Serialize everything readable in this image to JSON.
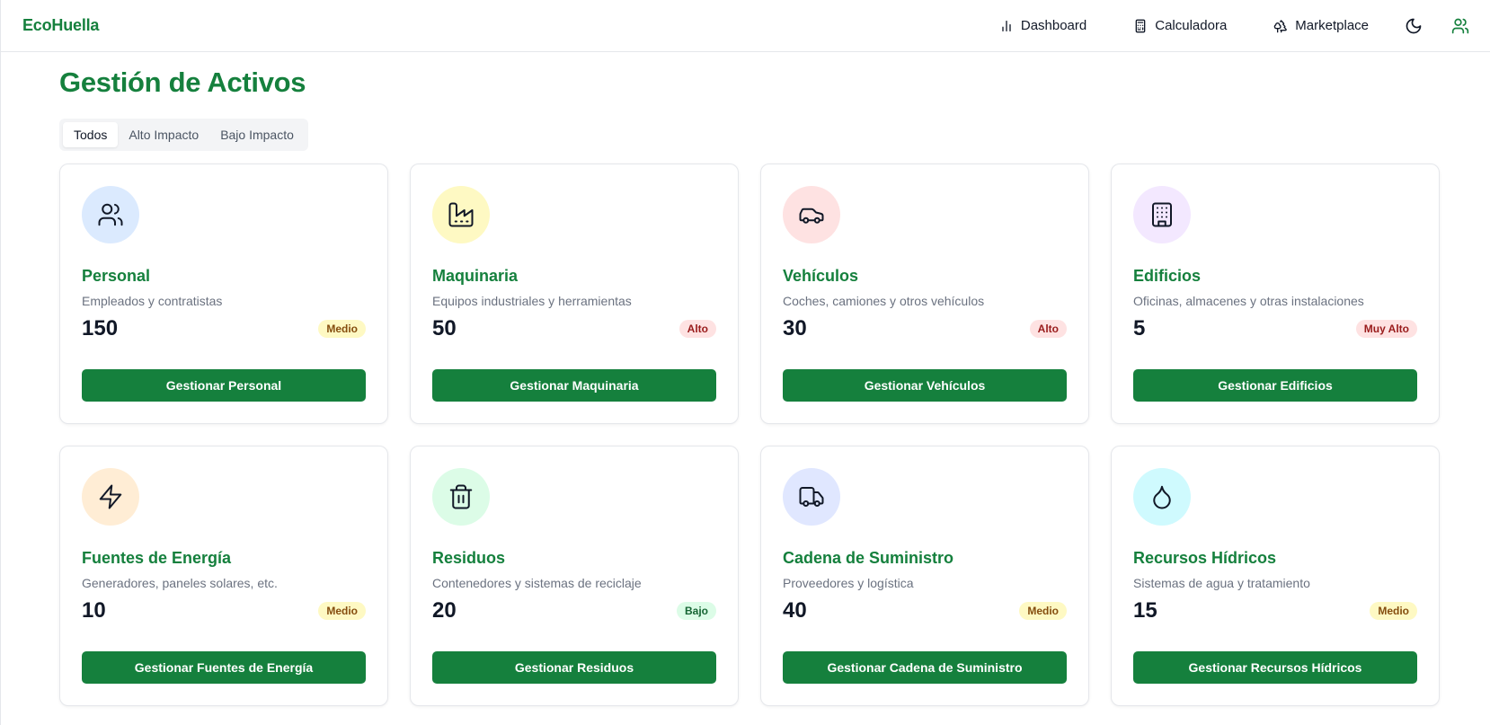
{
  "app": {
    "brand": "EcoHuella"
  },
  "nav": {
    "items": [
      {
        "label": "Dashboard",
        "icon": "bar-chart-icon"
      },
      {
        "label": "Calculadora",
        "icon": "calculator-icon"
      },
      {
        "label": "Marketplace",
        "icon": "trees-icon"
      }
    ],
    "theme_icon": "moon-icon",
    "user_icon": "users-icon"
  },
  "page": {
    "title": "Gestión de Activos"
  },
  "tabs": [
    {
      "label": "Todos",
      "active": true
    },
    {
      "label": "Alto Impacto",
      "active": false
    },
    {
      "label": "Bajo Impacto",
      "active": false
    }
  ],
  "colors": {
    "brand": "#15803d",
    "badge_medio_bg": "#fef9c3",
    "badge_medio_fg": "#854d0e",
    "badge_alto_bg": "#fee2e2",
    "badge_alto_fg": "#991b1b",
    "badge_bajo_bg": "#dcfce7",
    "badge_bajo_fg": "#166534"
  },
  "cards": [
    {
      "title": "Personal",
      "desc": "Empleados y contratistas",
      "count": "150",
      "impact": "Medio",
      "button": "Gestionar Personal",
      "icon": "users-icon",
      "icon_bg": "#dbeafe"
    },
    {
      "title": "Maquinaria",
      "desc": "Equipos industriales y herramientas",
      "count": "50",
      "impact": "Alto",
      "button": "Gestionar Maquinaria",
      "icon": "factory-icon",
      "icon_bg": "#fef9c3"
    },
    {
      "title": "Vehículos",
      "desc": "Coches, camiones y otros vehículos",
      "count": "30",
      "impact": "Alto",
      "button": "Gestionar Vehículos",
      "icon": "car-icon",
      "icon_bg": "#fee2e2"
    },
    {
      "title": "Edificios",
      "desc": "Oficinas, almacenes y otras instalaciones",
      "count": "5",
      "impact": "Muy Alto",
      "button": "Gestionar Edificios",
      "icon": "building-icon",
      "icon_bg": "#f3e8ff"
    },
    {
      "title": "Fuentes de Energía",
      "desc": "Generadores, paneles solares, etc.",
      "count": "10",
      "impact": "Medio",
      "button": "Gestionar Fuentes de Energía",
      "icon": "zap-icon",
      "icon_bg": "#ffedd5"
    },
    {
      "title": "Residuos",
      "desc": "Contenedores y sistemas de reciclaje",
      "count": "20",
      "impact": "Bajo",
      "button": "Gestionar Residuos",
      "icon": "trash-icon",
      "icon_bg": "#dcfce7"
    },
    {
      "title": "Cadena de Suministro",
      "desc": "Proveedores y logística",
      "count": "40",
      "impact": "Medio",
      "button": "Gestionar Cadena de Suministro",
      "icon": "truck-icon",
      "icon_bg": "#e0e7ff"
    },
    {
      "title": "Recursos Hídricos",
      "desc": "Sistemas de agua y tratamiento",
      "count": "15",
      "impact": "Medio",
      "button": "Gestionar Recursos Hídricos",
      "icon": "droplet-icon",
      "icon_bg": "#cffafe"
    }
  ]
}
